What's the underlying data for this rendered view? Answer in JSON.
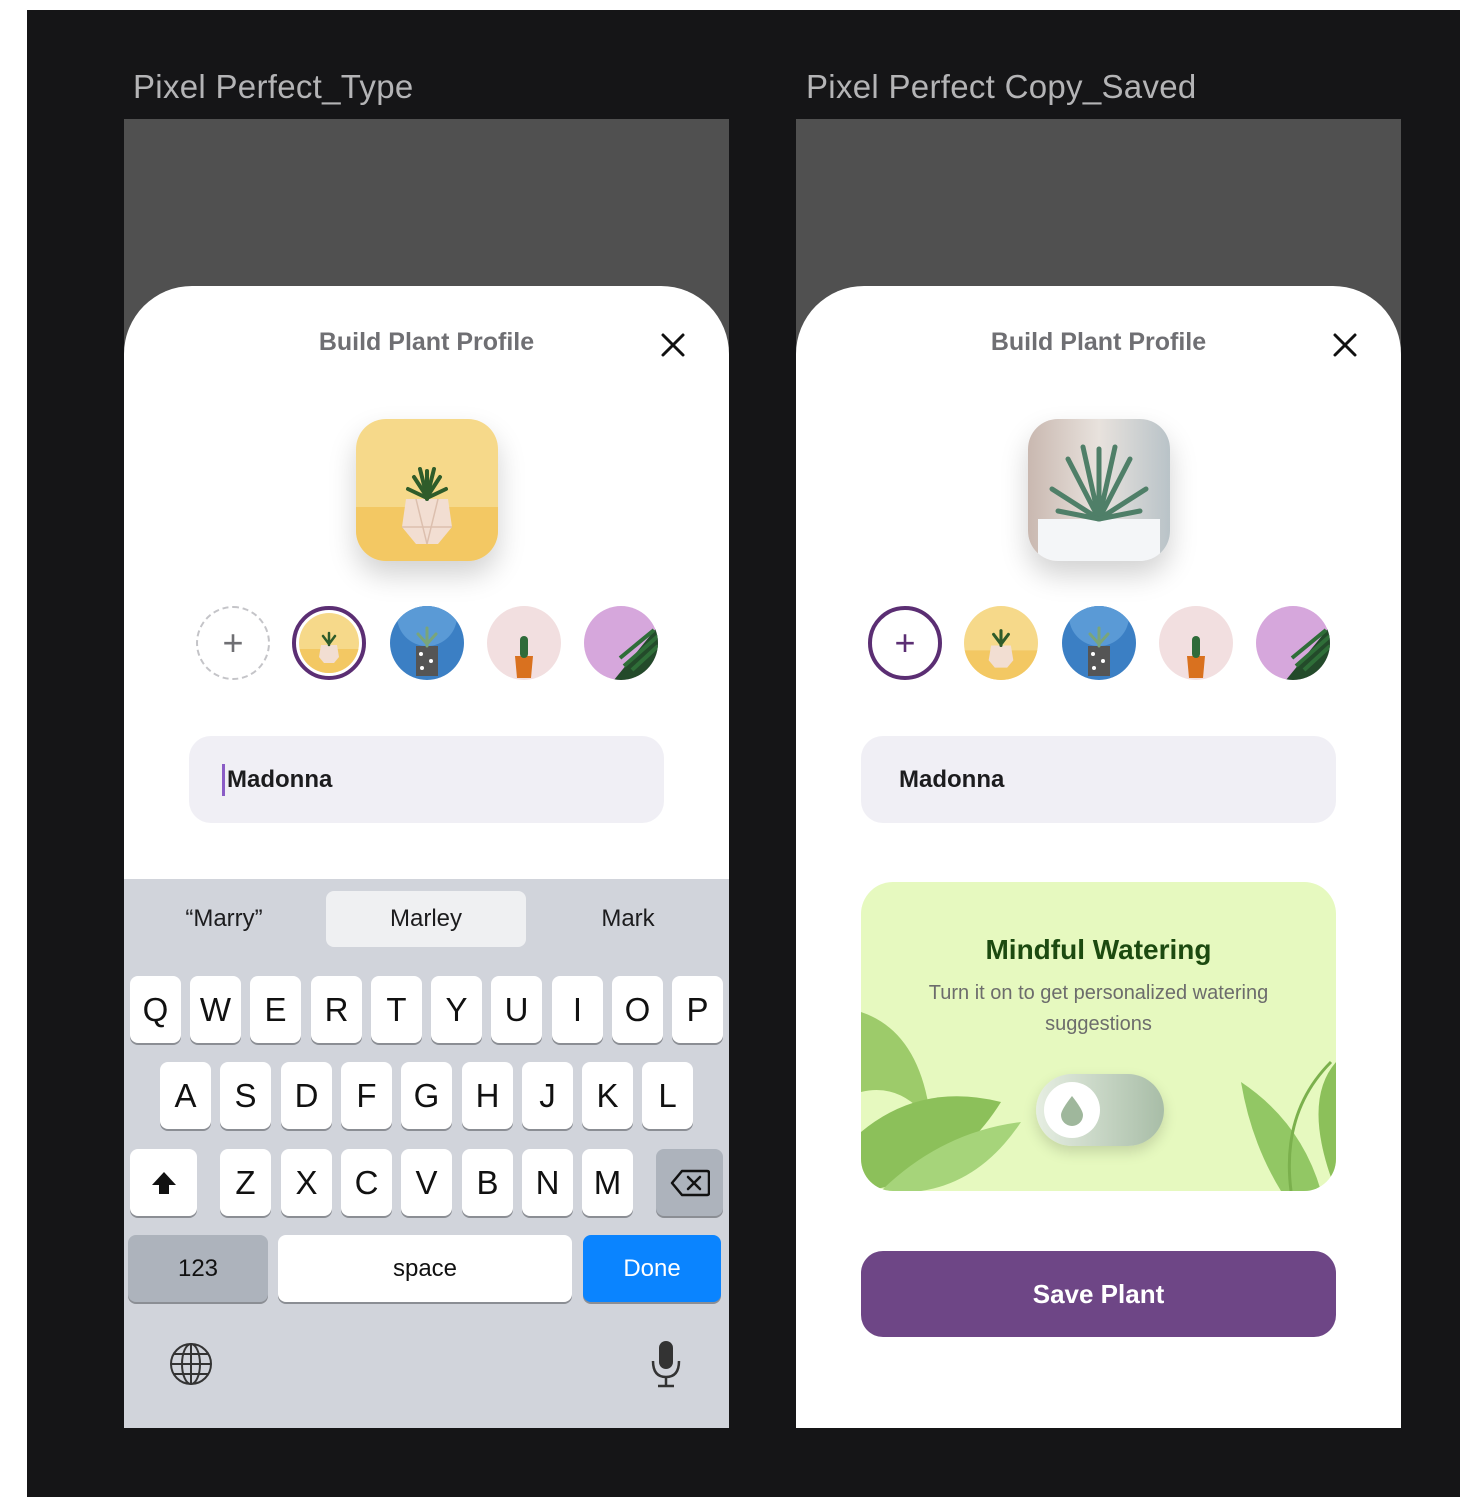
{
  "frames": {
    "left": {
      "label": "Pixel Perfect_Type",
      "title": "Build Plant Profile",
      "name_value": "Madonna"
    },
    "right": {
      "label": "Pixel Perfect Copy_Saved",
      "title": "Build Plant Profile",
      "name_value": "Madonna",
      "mindful": {
        "title": "Mindful Watering",
        "subtitle": "Turn it on to get personalized watering suggestions"
      },
      "save_label": "Save Plant"
    }
  },
  "keyboard": {
    "suggestions": [
      "“Marry”",
      "Marley",
      "Mark"
    ],
    "row1": [
      "Q",
      "W",
      "E",
      "R",
      "T",
      "Y",
      "U",
      "I",
      "O",
      "P"
    ],
    "row2": [
      "A",
      "S",
      "D",
      "F",
      "G",
      "H",
      "J",
      "K",
      "L"
    ],
    "row3": [
      "Z",
      "X",
      "C",
      "V",
      "B",
      "N",
      "M"
    ],
    "numbers_label": "123",
    "space_label": "space",
    "done_label": "Done"
  },
  "thumbnail_images": [
    "yellow-succulent-pot",
    "blue-cactus-pot",
    "pink-cactus-pot",
    "purple-palm-leaf"
  ],
  "colors": {
    "accent_purple": "#6e4686",
    "selected_ring": "#5b2e73",
    "done_blue": "#0a84ff",
    "mindful_bg": "#e6f9bf",
    "mindful_title": "#1c4a10"
  }
}
